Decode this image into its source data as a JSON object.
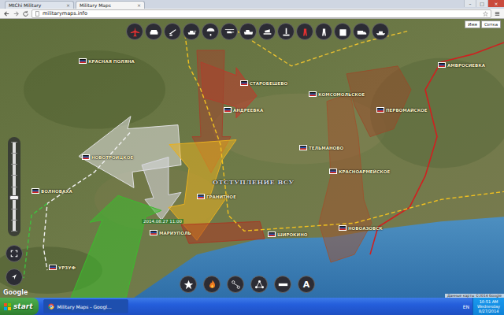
{
  "browser": {
    "tabs": [
      {
        "label": "MtChi Military",
        "selected": false
      },
      {
        "label": "Military Maps",
        "selected": true
      }
    ],
    "close": "×",
    "address": "militarymaps.info",
    "window_controls": [
      "–",
      "□",
      "×"
    ]
  },
  "map": {
    "layer_buttons": [
      {
        "label": "Имя",
        "selected": false
      },
      {
        "label": "Сетка",
        "selected": false
      }
    ],
    "zoom": {
      "level": 0.38
    },
    "banner": "ОТСТУПЛЕНИЕ ВСУ",
    "places": [
      {
        "name": "КРАСНАЯ ПОЛЯНА"
      },
      {
        "name": "СТАРОБЕШЕВО"
      },
      {
        "name": "АНДРЕЕВКА"
      },
      {
        "name": "КОМСОМОЛЬСКОЕ"
      },
      {
        "name": "ТЕЛЬМАНОВО"
      },
      {
        "name": "НОВОТРОИЦКОЕ"
      },
      {
        "name": "ВОЛНОВАХА"
      },
      {
        "name": "ГРАНИТНОЕ"
      },
      {
        "name": "КРАСНОАРМЕЙСКОЕ"
      },
      {
        "name": "МАРИУПОЛЬ"
      },
      {
        "name": "ШИРОКИНО"
      },
      {
        "name": "НОВОАЗОВСК"
      },
      {
        "name": "ПЕРВОМАЙСКОЕ"
      },
      {
        "name": "АМВРОСИЕВКА"
      },
      {
        "name": "УРЗУФ"
      }
    ],
    "timestamps": [
      "2014.08.27 11:00"
    ],
    "overlays": [
      {
        "kind": "arrow",
        "color": "#c0392b"
      },
      {
        "kind": "arrow",
        "color": "#a0452d"
      },
      {
        "kind": "arrow",
        "color": "#e0e0e0"
      },
      {
        "kind": "arrow",
        "color": "#d8d8e0"
      },
      {
        "kind": "arrow",
        "color": "#e8b020"
      },
      {
        "kind": "arrow",
        "color": "#3dbb2e"
      },
      {
        "kind": "zone",
        "color": "#a0522d"
      },
      {
        "kind": "zone",
        "color": "#9a4a2a"
      },
      {
        "kind": "zone",
        "color": "#b03020"
      },
      {
        "kind": "line",
        "color": "#d02020"
      },
      {
        "kind": "route",
        "color": "#f0c020"
      },
      {
        "kind": "route",
        "color": "#e8c030"
      },
      {
        "kind": "route",
        "color": "#f0f0f0"
      },
      {
        "kind": "route",
        "color": "#40c040"
      }
    ],
    "text_tool": "A",
    "logo": "Google",
    "attribution": "Данные карты ©2014 Google"
  },
  "taskbar": {
    "start": "start",
    "items": [
      {
        "label": "Military Maps - Googl...",
        "selected": true
      }
    ],
    "tray": {
      "lang": "EN",
      "time": "10:51 AM",
      "day": "Wednesday",
      "date": "8/27/2014"
    }
  }
}
